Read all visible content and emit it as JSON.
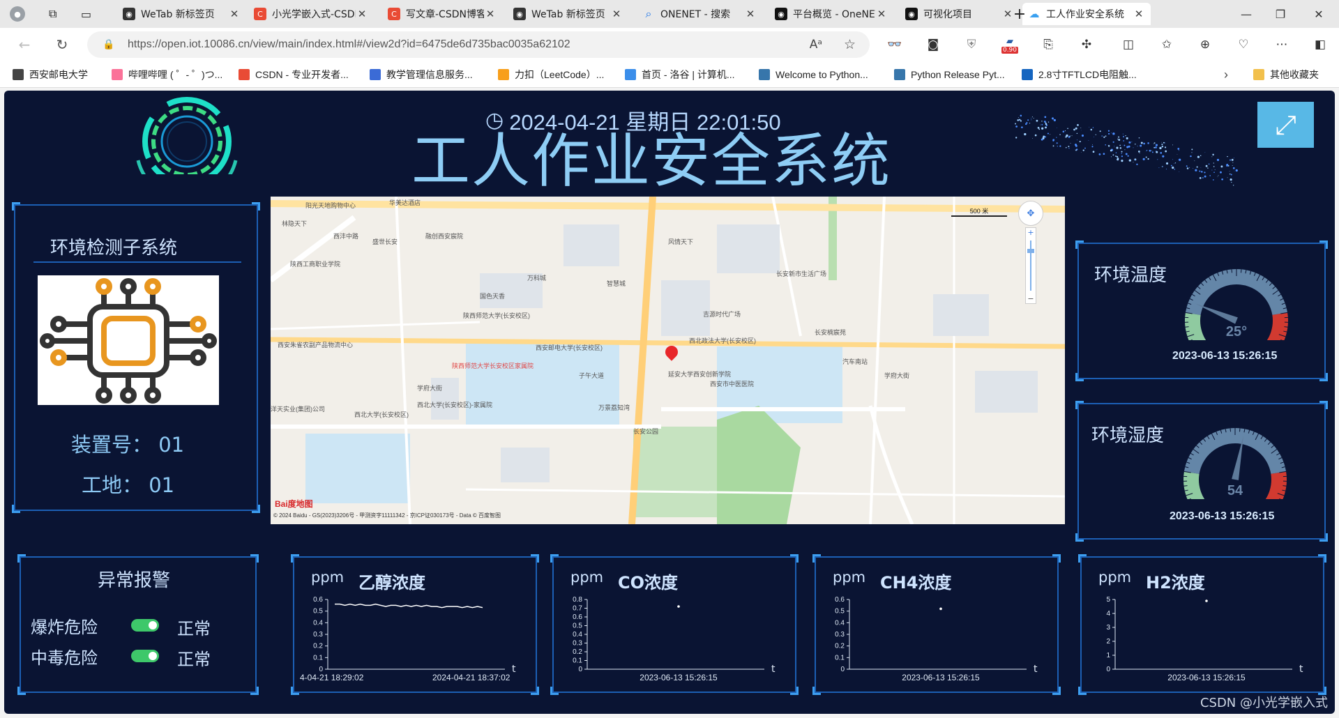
{
  "browser": {
    "tabs": [
      {
        "label": "WeTab 新标签页",
        "icon_color": "#333333",
        "icon": "wetab-icon"
      },
      {
        "label": "小光学嵌入式-CSDN",
        "icon_color": "#e94b35",
        "icon": "csdn-icon"
      },
      {
        "label": "写文章-CSDN博客",
        "icon_color": "#e94b35",
        "icon": "csdn-icon"
      },
      {
        "label": "WeTab 新标签页",
        "icon_color": "#333333",
        "icon": "wetab-icon"
      },
      {
        "label": "ONENET - 搜索",
        "icon_color": "#1a73e8",
        "icon": "search-icon"
      },
      {
        "label": "平台概览 - OneNET",
        "icon_color": "#111111",
        "icon": "onenet-icon"
      },
      {
        "label": "可视化项目",
        "icon_color": "#111111",
        "icon": "onenet-icon"
      },
      {
        "label": "工人作业安全系统",
        "icon_color": "#3aa0f0",
        "icon": "cloud-icon"
      }
    ],
    "url": "https://open.iot.10086.cn/view/main/index.html#/view2d?id=6475de6d735bac0035a62102",
    "badge": "0.90",
    "favorites": [
      {
        "label": "西安邮电大学",
        "icon_color": "#444444"
      },
      {
        "label": "哔哩哔哩 ( ゜- ゜)つ...",
        "icon_color": "#fb7299"
      },
      {
        "label": "CSDN - 专业开发者...",
        "icon_color": "#e94b35"
      },
      {
        "label": "教学管理信息服务...",
        "icon_color": "#3b6bd6"
      },
      {
        "label": "力扣（LeetCode）...",
        "icon_color": "#f89f1b"
      },
      {
        "label": "首页 - 洛谷 | 计算机...",
        "icon_color": "#3b8eea"
      },
      {
        "label": "Welcome to Python...",
        "icon_color": "#3776ab"
      },
      {
        "label": "Python Release Pyt...",
        "icon_color": "#3776ab"
      },
      {
        "label": "2.8寸TFTLCD电阻触...",
        "icon_color": "#1565c0"
      },
      {
        "label": "其他收藏夹",
        "icon_color": "#f2c04c"
      }
    ]
  },
  "dashboard": {
    "datetime": "2024-04-21 星期日 22:01:50",
    "title": "工人作业安全系统",
    "env_panel": {
      "title": "环境检测子系统",
      "device_line": "装置号：  01",
      "site_line": "工地：  01"
    },
    "map": {
      "scale_label": "500 米",
      "copyright": "© 2024 Baidu - GS(2023)3206号 - 甲测资字11111342 - 京ICP证030173号 - Data © 百度智图",
      "logo": "Bai度地图",
      "places": [
        "阳光天地购物中心",
        "华美达酒店",
        "林隐天下",
        "西沣中路",
        "盛世长安",
        "融创西安宸院",
        "风情天下",
        "陕西工商职业学院",
        "万科城",
        "智慧城",
        "长安新市生活广场",
        "国色天香",
        "吉源时代广场",
        "陕西师范大学(长安校区)",
        "西安邮电大学(长安校区)",
        "西北政法大学(长安校区)",
        "长安楠宸苑",
        "西安朱雀农副产品物流中心",
        "陕西师范大学长安校区家属院",
        "子午大道",
        "学府大街",
        "延安大学西安创新学院",
        "汽车南站",
        "学府大街",
        "西安市中医医院",
        "西北大学(长安校区)",
        "西北大学(长安校区)-家属院",
        "万景荔知湾",
        "长安公园",
        "洋天实业(集团)公司"
      ]
    },
    "gauges": [
      {
        "title": "环境温度",
        "value": 25,
        "value_label": "25°",
        "max": 100,
        "date": "2023-06-13 15:26:15"
      },
      {
        "title": "环境湿度",
        "value": 54,
        "value_label": "54",
        "max": 100,
        "date": "2023-06-13 15:26:15"
      }
    ],
    "alarm": {
      "title": "异常报警",
      "rows": [
        {
          "label": "爆炸危险",
          "status": "正常"
        },
        {
          "label": "中毒危险",
          "status": "正常"
        }
      ]
    },
    "watermark": "CSDN @小光学嵌入式"
  },
  "chart_data": [
    {
      "type": "line",
      "title": "乙醇浓度",
      "ylabel": "ppm",
      "xlabel": "t",
      "ylim": [
        0,
        0.6
      ],
      "yticks": [
        "0",
        "0.1",
        "0.2",
        "0.3",
        "0.4",
        "0.5",
        "0.6"
      ],
      "xtick_labels": [
        "4-04-21 18:29:02",
        "2024-04-21 18:37:02"
      ],
      "series": [
        {
          "values": [
            0.56,
            0.56,
            0.55,
            0.56,
            0.55,
            0.56,
            0.55,
            0.55,
            0.56,
            0.55,
            0.54,
            0.55,
            0.55,
            0.54,
            0.55,
            0.54,
            0.55,
            0.54,
            0.55,
            0.54,
            0.54,
            0.53,
            0.54,
            0.54,
            0.54,
            0.53,
            0.54,
            0.53,
            0.54,
            0.53
          ]
        }
      ]
    },
    {
      "type": "scatter",
      "title": "CO浓度",
      "ylabel": "ppm",
      "xlabel": "t",
      "ylim": [
        0,
        0.8
      ],
      "yticks": [
        "0",
        "0.1",
        "0.2",
        "0.3",
        "0.4",
        "0.5",
        "0.6",
        "0.7",
        "0.8"
      ],
      "xtick_labels": [
        "2023-06-13 15:26:15"
      ],
      "series": [
        {
          "values": [
            0.72
          ]
        }
      ]
    },
    {
      "type": "scatter",
      "title": "CH4浓度",
      "ylabel": "ppm",
      "xlabel": "t",
      "ylim": [
        0,
        0.6
      ],
      "yticks": [
        "0",
        "0.1",
        "0.2",
        "0.3",
        "0.4",
        "0.5",
        "0.6"
      ],
      "xtick_labels": [
        "2023-06-13 15:26:15"
      ],
      "series": [
        {
          "values": [
            0.52
          ]
        }
      ]
    },
    {
      "type": "scatter",
      "title": "H2浓度",
      "ylabel": "ppm",
      "xlabel": "t",
      "ylim": [
        0,
        5
      ],
      "yticks": [
        "0",
        "1",
        "2",
        "3",
        "4",
        "5"
      ],
      "xtick_labels": [
        "2023-06-13 15:26:15"
      ],
      "series": [
        {
          "values": [
            4.9
          ]
        }
      ]
    }
  ]
}
